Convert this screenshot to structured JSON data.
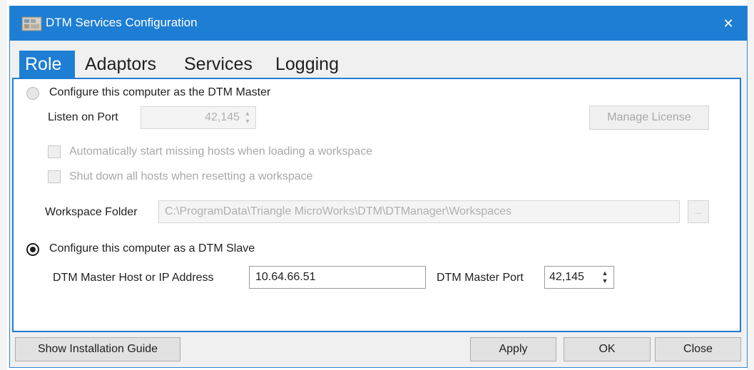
{
  "window": {
    "title": "DTM Services Configuration",
    "accent_color": "#1e7ed3",
    "close_glyph": "✕"
  },
  "tabs": [
    {
      "label": "Role",
      "active": true
    },
    {
      "label": "Adaptors",
      "active": false
    },
    {
      "label": "Services",
      "active": false
    },
    {
      "label": "Logging",
      "active": false
    }
  ],
  "master": {
    "radio_label": "Configure this computer as the DTM Master",
    "selected": false,
    "port_label": "Listen on Port",
    "port_value": "42,145",
    "manage_license_label": "Manage License",
    "auto_start_label": "Automatically start missing hosts when loading a workspace",
    "auto_start_checked": false,
    "shutdown_label": "Shut down all hosts when resetting a workspace",
    "shutdown_checked": false,
    "workspace_label": "Workspace Folder",
    "workspace_value": "C:\\ProgramData\\Triangle MicroWorks\\DTM\\DTManager\\Workspaces",
    "browse_label": "..."
  },
  "slave": {
    "radio_label": "Configure this computer as a DTM Slave",
    "selected": true,
    "host_label": "DTM Master Host or IP Address",
    "host_value": "10.64.66.51",
    "port_label": "DTM Master Port",
    "port_value": "42,145"
  },
  "footer": {
    "guide_label": "Show Installation Guide",
    "apply_label": "Apply",
    "ok_label": "OK",
    "close_label": "Close"
  }
}
